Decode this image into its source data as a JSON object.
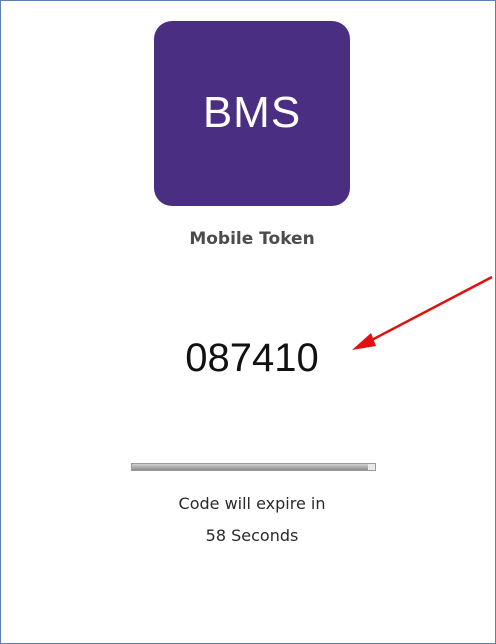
{
  "app": {
    "logo_text": "BMS",
    "subtitle": "Mobile Token",
    "logo_color": "#4a2e82"
  },
  "token": {
    "code": "087410",
    "expire_text": "Code will expire in",
    "seconds_text": "58 Seconds",
    "progress_fraction": 0.97
  },
  "annotation": {
    "arrow_icon": "red-arrow-icon",
    "arrow_color": "#e01010"
  }
}
